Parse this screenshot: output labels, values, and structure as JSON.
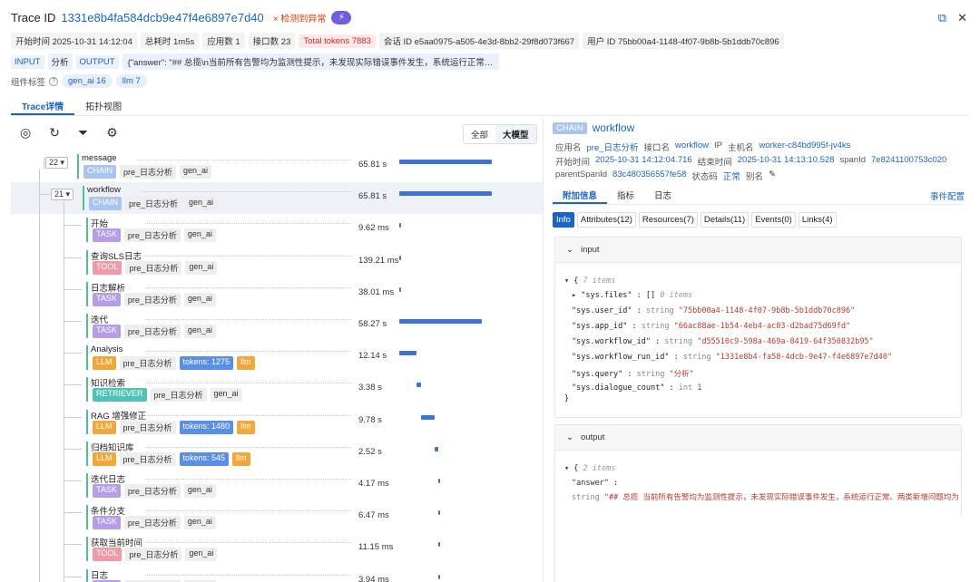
{
  "header": {
    "trace_label": "Trace ID",
    "trace_id": "1331e8b4fa584dcb9e47f4e6897e7d40",
    "warn_text": "× 检测到异常",
    "icon_pill": "⚡"
  },
  "meta": [
    "开始时间 2025-10-31 14:12:04",
    "总耗时 1m5s",
    "应用数 1",
    "接口数 23",
    "Total tokens 7883",
    "会话 ID e5aa0975-a505-4e3d-8bb2-29f8d073f667",
    "用户 ID 75bb00a4-1148-4f07-9b8b-5b1ddb70c896"
  ],
  "io": {
    "input_label": "INPUT",
    "input_value": "分析",
    "output_label": "OUTPUT",
    "output_value": "{\"answer\": \"## 总揽\\n当前所有告警均为监测性提示，未发现实际错误事件发生，系统运行正常。两类新增问..."
  },
  "component_tags": {
    "label": "组件标签",
    "tags": [
      "gen_ai 16",
      "llm 7"
    ]
  },
  "tabs": [
    "Trace详情",
    "拓扑视图"
  ],
  "left": {
    "seg_all": "全部",
    "seg_llm": "大模型",
    "spans": [
      {
        "count": "22 ▾",
        "name": "message",
        "type": "CHAIN",
        "tags": [
          "pre_日志分析",
          "gen_ai"
        ],
        "dur": "65.81 s",
        "bar_start": 0.0,
        "bar_len": 1.0,
        "selected": false
      },
      {
        "count": "21 ▾",
        "name": "workflow",
        "type": "CHAIN",
        "tags": [
          "pre_日志分析",
          "gen_ai"
        ],
        "dur": "65.81 s",
        "bar_start": 0.0,
        "bar_len": 1.0,
        "selected": true
      },
      {
        "name": "开始",
        "type": "TASK",
        "tags": [
          "pre_日志分析",
          "gen_ai"
        ],
        "dur": "9.62 ms",
        "bar_start": 0.0,
        "bar_len": 0.0002
      },
      {
        "name": "查询SLS日志",
        "type": "TOOL",
        "tags": [
          "pre_日志分析",
          "gen_ai"
        ],
        "dur": "139.21 ms",
        "bar_start": 0.0,
        "bar_len": 0.002
      },
      {
        "name": "日志解析",
        "type": "TASK",
        "tags": [
          "pre_日志分析",
          "gen_ai"
        ],
        "dur": "38.01 ms",
        "bar_start": 0.002,
        "bar_len": 0.0006
      },
      {
        "name": "迭代",
        "type": "TASK",
        "tags": [
          "pre_日志分析",
          "gen_ai"
        ],
        "dur": "58.27 s",
        "bar_start": 0.003,
        "bar_len": 0.885
      },
      {
        "name": "Analysis",
        "type": "LLM",
        "tags": [
          "pre_日志分析"
        ],
        "tokens": "tokens: 1275",
        "llm": "llm",
        "dur": "12.14 s",
        "bar_start": 0.003,
        "bar_len": 0.184
      },
      {
        "name": "知识检索",
        "type": "RETRIEVER",
        "tags": [
          "pre_日志分析",
          "gen_ai"
        ],
        "dur": "3.38 s",
        "bar_start": 0.187,
        "bar_len": 0.051
      },
      {
        "name": "RAG 增强修正",
        "type": "LLM",
        "tags": [
          "pre_日志分析"
        ],
        "tokens": "tokens: 1480",
        "llm": "llm",
        "dur": "9.78 s",
        "bar_start": 0.238,
        "bar_len": 0.149
      },
      {
        "name": "归档知识库",
        "type": "LLM",
        "tags": [
          "pre_日志分析"
        ],
        "tokens": "tokens: 545",
        "llm": "llm",
        "dur": "2.52 s",
        "bar_start": 0.387,
        "bar_len": 0.038
      },
      {
        "name": "迭代日志",
        "type": "TASK",
        "tags": [
          "pre_日志分析",
          "gen_ai"
        ],
        "dur": "4.17 ms",
        "bar_start": 0.425,
        "bar_len": 0.0001
      },
      {
        "name": "条件分支",
        "type": "TASK",
        "tags": [
          "pre_日志分析",
          "gen_ai"
        ],
        "dur": "6.47 ms",
        "bar_start": 0.425,
        "bar_len": 0.0001
      },
      {
        "name": "获取当前时间",
        "type": "TOOL",
        "tags": [
          "pre_日志分析",
          "gen_ai"
        ],
        "dur": "11.15 ms",
        "bar_start": 0.425,
        "bar_len": 0.0002
      },
      {
        "name": "日志",
        "type": "TASK",
        "tags": [
          "pre_日志分析",
          "gen_ai"
        ],
        "dur": "3.94 ms",
        "bar_start": 0.425,
        "bar_len": 0.0001
      }
    ]
  },
  "right": {
    "type": "CHAIN",
    "name": "workflow",
    "app_label": "应用名",
    "app_value": "pre_日志分析",
    "api_label": "接口名",
    "api_value": "workflow",
    "ip_label": "IP",
    "host_label": "主机名",
    "host_value": "worker-c84bd995f-jv4ks",
    "start_label": "开始时间",
    "start_value": "2025-10-31 14:12:04.716",
    "end_label": "结束时间",
    "end_value": "2025-10-31 14:13:10.528",
    "spanid_label": "spanId",
    "spanid_value": "7e8241100753c020",
    "parent_label": "parentSpanId",
    "parent_value": "83c480356557fe58",
    "status_label": "状态码",
    "status_value": "正常",
    "alias_label": "别名",
    "tabs": [
      "附加信息",
      "指标",
      "日志"
    ],
    "event_config": "事件配置",
    "subtabs": [
      "Info",
      "Attributes(12)",
      "Resources(7)",
      "Details(11)",
      "Events(0)",
      "Links(4)"
    ],
    "input": {
      "title": "input",
      "count": "7 items",
      "files_key": "\"sys.files\"",
      "files_val": "[]",
      "files_count": "0 items",
      "lines": [
        {
          "key": "\"sys.user_id\"",
          "type": "string",
          "val": "\"75bb00a4-1148-4f07-9b8b-5b1ddb70c896\""
        },
        {
          "key": "\"sys.app_id\"",
          "type": "string",
          "val": "\"66ac88ae-1b54-4eb4-ac03-d2bad75d69fd\""
        },
        {
          "key": "\"sys.workflow_id\"",
          "type": "string",
          "val": "\"d55510c9-598a-469a-8419-64f350832b95\""
        },
        {
          "key": "\"sys.workflow_run_id\"",
          "type": "string",
          "val": "\"1331e8b4-fa58-4dcb-9e47-f4e6897e7d40\""
        },
        {
          "key": "\"sys.query\"",
          "type": "string",
          "val": "\"分析\""
        },
        {
          "key": "\"sys.dialogue_count\"",
          "type": "int",
          "val": "1"
        }
      ]
    },
    "output": {
      "title": "output",
      "count": "2 items",
      "answer_key": "\"answer\" :",
      "answer_type": "string",
      "answer_val": "\"## 总揽  当前所有告警均为监测性提示，未发现实际错误事件发生，系统运行正常。两类新增问题均为"
    }
  }
}
